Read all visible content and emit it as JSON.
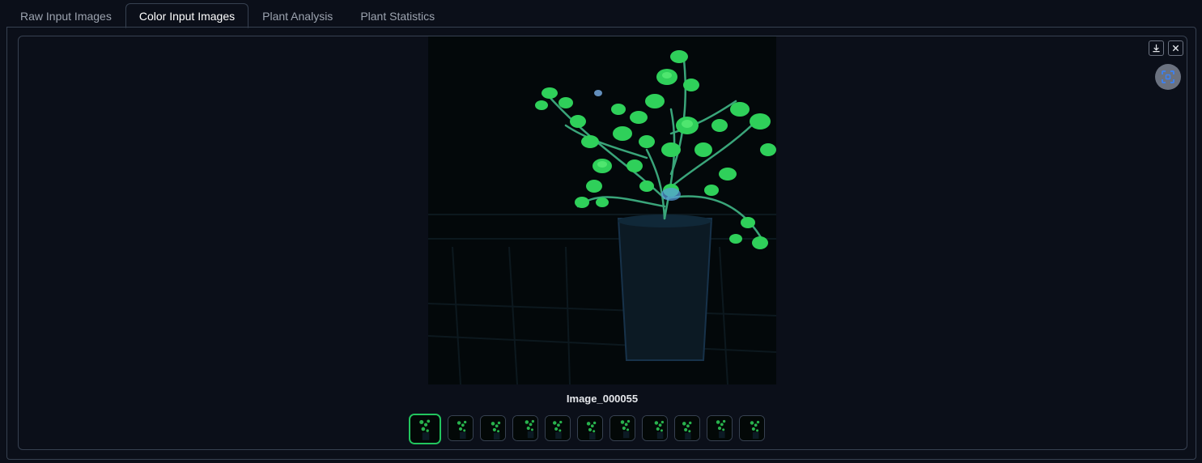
{
  "tabs": [
    {
      "label": "Raw Input Images"
    },
    {
      "label": "Color Input Images"
    },
    {
      "label": "Plant Analysis"
    },
    {
      "label": "Plant Statistics"
    }
  ],
  "active_tab": "Color Input Images",
  "gallery": {
    "caption": "Image_000055",
    "thumbnail_count": 11,
    "selected_index": 0,
    "accent_color": "#22c55e",
    "icons": [
      "download-icon",
      "close-icon",
      "fullscreen-icon"
    ]
  }
}
